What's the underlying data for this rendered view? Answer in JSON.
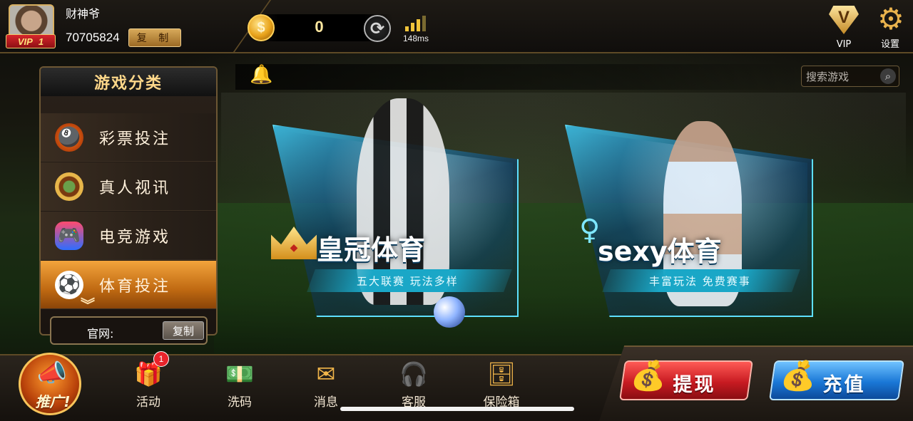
{
  "header": {
    "nickname": "财神爷",
    "user_id": "70705824",
    "copy_label": "复 制",
    "vip_badge_prefix": "VIP",
    "vip_level": "1",
    "coin_symbol": "$",
    "coin_balance": "0",
    "latency": "148ms",
    "vip_label": "VIP",
    "vip_emblem": "V",
    "settings_label": "设置"
  },
  "search": {
    "placeholder": "搜索游戏"
  },
  "category_panel": {
    "title": "游戏分类",
    "items": [
      {
        "label": "彩票投注",
        "icon": "lottery-ball-icon",
        "active": false
      },
      {
        "label": "真人视讯",
        "icon": "roulette-icon",
        "active": false
      },
      {
        "label": "电竞游戏",
        "icon": "gamepad-icon",
        "active": false
      },
      {
        "label": "体育投注",
        "icon": "soccer-ball-icon",
        "active": true
      }
    ],
    "website_label": "官网:",
    "website_copy_label": "复制"
  },
  "games": [
    {
      "name": "皇冠体育",
      "subtitle": "五大联赛 玩法多样",
      "icon": "crown-icon"
    },
    {
      "name": "sexy体育",
      "subtitle": "丰富玩法 免费赛事",
      "icon": "dancer-icon"
    }
  ],
  "bottom_nav": {
    "promo_label": "推广!",
    "items": [
      {
        "label": "活动",
        "icon": "gift-icon",
        "badge": "1"
      },
      {
        "label": "洗码",
        "icon": "cash-icon"
      },
      {
        "label": "消息",
        "icon": "envelope-icon"
      },
      {
        "label": "客服",
        "icon": "headset-icon"
      },
      {
        "label": "保险箱",
        "icon": "safe-icon"
      }
    ],
    "withdraw_label": "提现",
    "deposit_label": "充值"
  },
  "colors": {
    "gold_accent": "#e9b24c",
    "withdraw_red": "#c81b22",
    "deposit_blue": "#1a77d6",
    "card_cyan": "#5ee0ff"
  }
}
